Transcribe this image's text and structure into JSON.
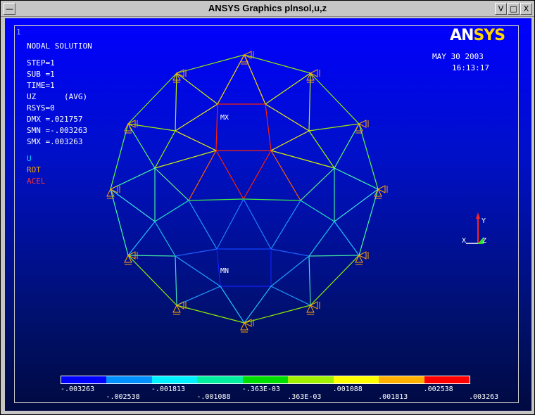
{
  "window": {
    "title": "ANSYS Graphics     plnsol,u,z",
    "menu_glyph": "—",
    "min_glyph": "V",
    "max_glyph": "□",
    "close_glyph": "X"
  },
  "plot": {
    "window_number": "1",
    "heading": "NODAL SOLUTION",
    "info_lines": [
      "STEP=1",
      "SUB =1",
      "TIME=1",
      "UZ      (AVG)",
      "RSYS=0",
      "DMX =.021757",
      "SMN =-.003263",
      "SMX =.003263"
    ],
    "legend_u": "U",
    "legend_rot": "ROT",
    "legend_acel": "ACEL",
    "date": "MAY 30 2003",
    "time": "16:13:17",
    "logo_prefix": "AN",
    "logo_suffix": "SYS",
    "mx_label": "MX",
    "mn_label": "MN",
    "triad_x": "X",
    "triad_y": "Y",
    "triad_z": "Z"
  },
  "contour_bar": {
    "colors": [
      "#0000ff",
      "#0090ff",
      "#00f0ff",
      "#00f0a0",
      "#00e000",
      "#a0f000",
      "#ffff00",
      "#ffb000",
      "#ff0000"
    ],
    "labels_top": [
      "-.003263",
      "-.001813",
      "-.363E-03",
      ".001088",
      ".002538"
    ],
    "labels_bottom": [
      "-.002538",
      "-.001088",
      ".363E-03",
      ".001813",
      ".003263"
    ]
  },
  "colors": {
    "background_top": "#0000ff",
    "background_bottom": "#000a40",
    "support_symbol": "#ffa500",
    "legend_u": "#00e0ff",
    "legend_rot": "#ffa500",
    "legend_acel": "#ff3030"
  }
}
